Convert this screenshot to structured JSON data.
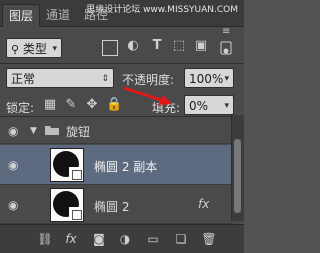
{
  "tabs": {
    "layers": "图层",
    "channels": "通道",
    "paths": "路径"
  },
  "watermark": "思缘设计论坛 www.MISSYUAN.COM",
  "filter": {
    "label": "类型"
  },
  "blend": {
    "mode": "正常",
    "opacity_label": "不透明度:",
    "opacity_value": "100%"
  },
  "lock": {
    "label": "锁定:",
    "fill_label": "填充:",
    "fill_value": "0%"
  },
  "layers": {
    "group_name": "旋钮",
    "items": [
      {
        "name": "椭圆 2 副本",
        "selected": true,
        "fx": ""
      },
      {
        "name": "椭圆 2",
        "selected": false,
        "fx": "fx"
      }
    ]
  },
  "bottom": {
    "fx": "fx"
  },
  "colors": {
    "panel": "#4a4a4a",
    "selected_row": "#5e6a80",
    "arrow": "#e01818"
  },
  "icons": [
    "eye-icon",
    "folder-icon",
    "link-icon",
    "fx-icon",
    "mask-icon",
    "adjustment-icon",
    "new-group-icon",
    "new-layer-icon",
    "trash-icon"
  ]
}
